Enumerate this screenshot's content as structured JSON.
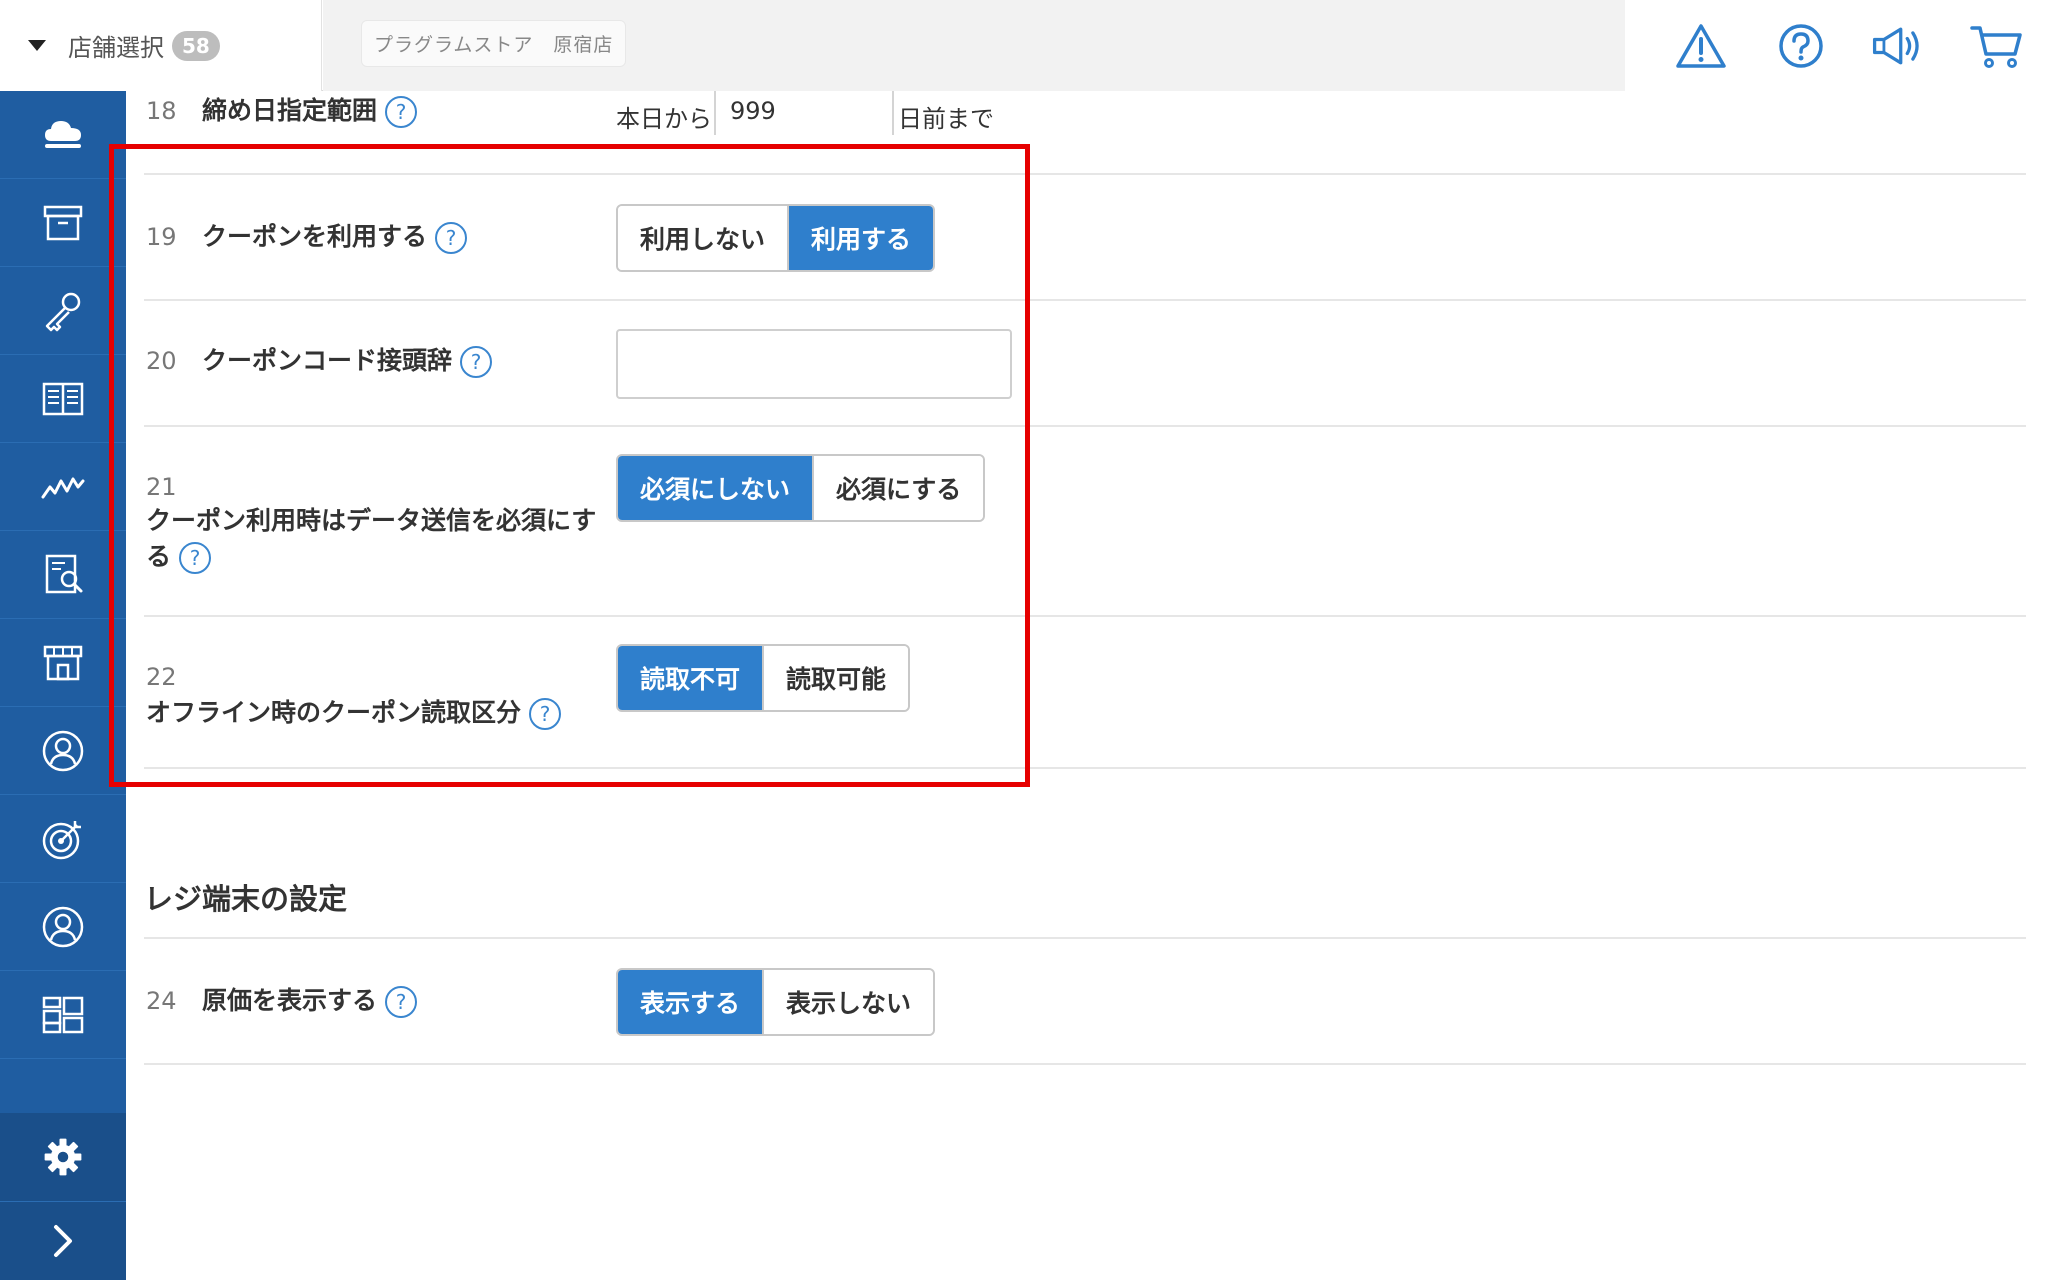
{
  "header": {
    "store_select_label": "店舗選択",
    "store_count": "58",
    "current_store": "プラグラムストア　原宿店",
    "icons": [
      "warning-icon",
      "help-icon",
      "announcement-icon",
      "cart-icon"
    ]
  },
  "sidebar": {
    "items": [
      "cloud-icon",
      "archive-box-icon",
      "key-icon",
      "book-icon",
      "chart-line-icon",
      "report-search-icon",
      "store-icon",
      "customer-icon",
      "target-icon",
      "user-icon",
      "grid-icon"
    ],
    "settings_icon": "gear-icon",
    "expand_icon": "chevron-right-icon"
  },
  "settings": {
    "row18": {
      "num": "18",
      "label": "締め日指定範囲",
      "prefix": "本日から",
      "value": "999",
      "suffix": "日前まで"
    },
    "row19": {
      "num": "19",
      "label": "クーポンを利用する",
      "options": [
        "利用しない",
        "利用する"
      ],
      "selected": 1
    },
    "row20": {
      "num": "20",
      "label": "クーポンコード接頭辞",
      "value": ""
    },
    "row21": {
      "num": "21",
      "label_line1": "クーポン利用時はデータ送信を必須にす",
      "label_line2": "る",
      "options": [
        "必須にしない",
        "必須にする"
      ],
      "selected": 0
    },
    "row22": {
      "num": "22",
      "label": "オフライン時のクーポン読取区分",
      "options": [
        "読取不可",
        "読取可能"
      ],
      "selected": 0
    }
  },
  "register_section": {
    "title": "レジ端末の設定",
    "row24": {
      "num": "24",
      "label": "原価を表示する",
      "options": [
        "表示する",
        "表示しない"
      ],
      "selected": 0
    }
  },
  "help_glyph": "?",
  "colors": {
    "sidebar": "#1f5da1",
    "accent": "#2f7fcc",
    "highlight": "#e60000"
  }
}
